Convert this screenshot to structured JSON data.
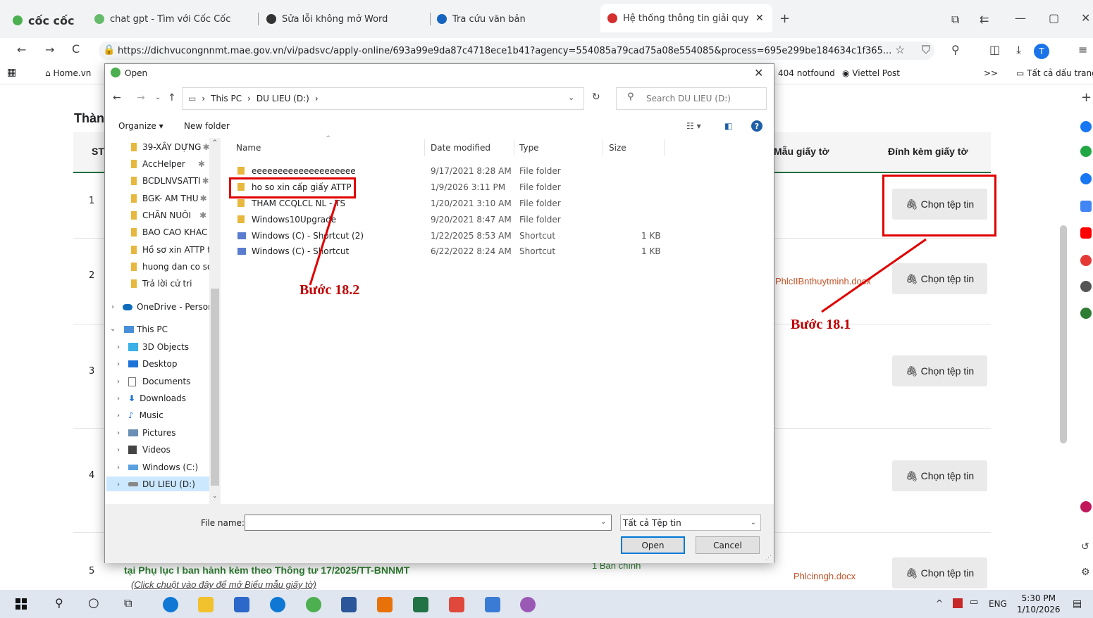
{
  "browser": {
    "brand": "cốc cốc",
    "tabs": [
      {
        "label": "chat gpt - Tìm với Cốc Cốc"
      },
      {
        "label": "Sửa lỗi không mở Word"
      },
      {
        "label": "Tra cứu văn bản"
      },
      {
        "label": "Hệ thống thông tin giải quy"
      }
    ],
    "url": "https://dichvucongnnmt.mae.gov.vn/vi/padsvc/apply-online/693a99e9da87c4718ece1b41?agency=554085a79cad75a08e554085&process=695e299be184634c1f365...",
    "bookmarks": [
      {
        "label": "Home.vn"
      },
      {
        "label": "404 notfound"
      },
      {
        "label": "Viettel Post"
      }
    ],
    "all_bookmarks": "Tất cả dấu trang",
    "more_bookmarks": ">>"
  },
  "page": {
    "title_partial": "Thàn",
    "col_stt": "ST",
    "col_template": "Mẫu giấy tờ",
    "col_attach": "Đính kèm giấy tờ",
    "rows": [
      {
        "num": "1",
        "btn": "Chọn tệp tin"
      },
      {
        "num": "2",
        "btn": "Chọn tệp tin",
        "template": "PhlcIIBnthuytminh.docx"
      },
      {
        "num": "3",
        "btn": "Chọn tệp tin"
      },
      {
        "num": "4",
        "btn": "Chọn tệp tin"
      },
      {
        "num": "5",
        "btn": "Chọn tệp tin",
        "template": "Phlcinngh.docx"
      }
    ],
    "row5_desc": "tại Phụ lục I ban hành kèm theo Thông tư 17/2025/TT-BNNMT",
    "row5_hint": "(Click chuột vào đây để mở Biểu mẫu giấy tờ)",
    "row5_qty": "1 Bản chính"
  },
  "annotations": {
    "step_1": "Bước 18.1",
    "step_2": "Bước 18.2",
    "color": "#e00000"
  },
  "dialog": {
    "title": "Open",
    "breadcrumb": [
      "This PC",
      "DU LIEU (D:)"
    ],
    "search_placeholder": "Search DU LIEU (D:)",
    "organize": "Organize ▾",
    "new_folder": "New folder",
    "nav_items": [
      {
        "label": "39-XÂY DỰNG"
      },
      {
        "label": "AccHelper"
      },
      {
        "label": "BCDLNVSATTI"
      },
      {
        "label": "BGK- AM THU"
      },
      {
        "label": "CHĂN NUÔI"
      },
      {
        "label": "BAO CAO KHAC"
      },
      {
        "label": "Hồ sơ xin ATTP tỉ"
      },
      {
        "label": "huong dan co so"
      },
      {
        "label": "Trả lời cử tri"
      },
      {
        "label": "OneDrive - Person"
      },
      {
        "label": "This PC"
      },
      {
        "label": "3D Objects"
      },
      {
        "label": "Desktop"
      },
      {
        "label": "Documents"
      },
      {
        "label": "Downloads"
      },
      {
        "label": "Music"
      },
      {
        "label": "Pictures"
      },
      {
        "label": "Videos"
      },
      {
        "label": "Windows (C:)"
      },
      {
        "label": "DU LIEU (D:)"
      }
    ],
    "columns": {
      "name": "Name",
      "date": "Date modified",
      "type": "Type",
      "size": "Size"
    },
    "files": [
      {
        "name": "eeeeeeeeeeeeeeeeeeee",
        "date": "9/17/2021 8:28 AM",
        "type": "File folder",
        "size": ""
      },
      {
        "name": "ho so xin cấp giấy ATTP",
        "date": "1/9/2026 3:11 PM",
        "type": "File folder",
        "size": ""
      },
      {
        "name": "THAM CCQLCL NL - TS",
        "date": "1/20/2021 3:10 AM",
        "type": "File folder",
        "size": ""
      },
      {
        "name": "Windows10Upgrade",
        "date": "9/20/2021 8:47 AM",
        "type": "File folder",
        "size": ""
      },
      {
        "name": "Windows (C) - Shortcut (2)",
        "date": "1/22/2025 8:53 AM",
        "type": "Shortcut",
        "size": "1 KB"
      },
      {
        "name": "Windows (C) - Shortcut",
        "date": "6/22/2022 8:24 AM",
        "type": "Shortcut",
        "size": "1 KB"
      }
    ],
    "file_name_label": "File name:",
    "file_name_value": "",
    "file_type": "Tất cả Tệp tin",
    "open_btn": "Open",
    "cancel_btn": "Cancel"
  },
  "taskbar": {
    "lang": "ENG",
    "time": "5:30 PM",
    "date": "1/10/2026"
  }
}
